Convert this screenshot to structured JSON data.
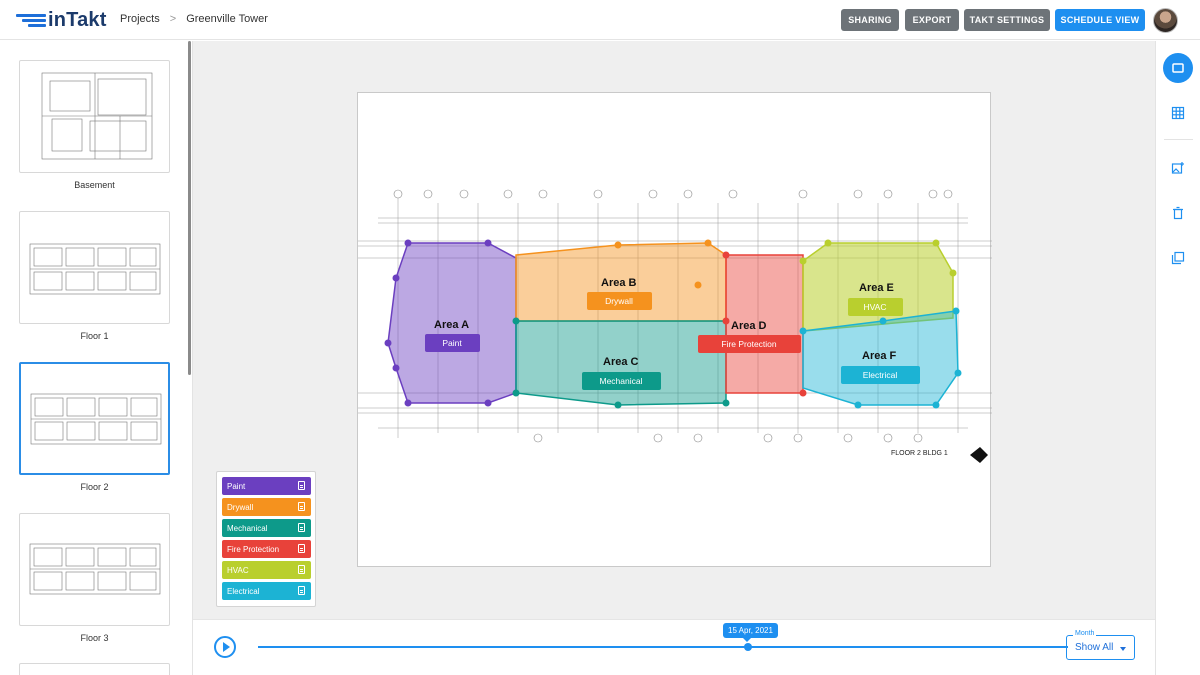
{
  "header": {
    "logo_text": "inTakt",
    "breadcrumb": {
      "root": "Projects",
      "separator": ">",
      "current": "Greenville Tower"
    },
    "buttons": {
      "sharing": "SHARING",
      "export": "EXPORT",
      "takt_settings": "TAKT SETTINGS",
      "schedule_view": "SCHEDULE VIEW"
    }
  },
  "sidebar": {
    "floors": [
      {
        "label": "Basement"
      },
      {
        "label": "Floor 1"
      },
      {
        "label": "Floor 2",
        "selected": true
      },
      {
        "label": "Floor 3"
      }
    ]
  },
  "plan": {
    "sheet_title": "FLOOR 2 BLDG 1",
    "areas": [
      {
        "name": "Area A",
        "trade": "Paint",
        "color": "#6b3fc0"
      },
      {
        "name": "Area B",
        "trade": "Drywall",
        "color": "#f5921e"
      },
      {
        "name": "Area C",
        "trade": "Mechanical",
        "color": "#0d9a8a"
      },
      {
        "name": "Area D",
        "trade": "Fire Protection",
        "color": "#e8423a"
      },
      {
        "name": "Area E",
        "trade": "HVAC",
        "color": "#b9cf2e"
      },
      {
        "name": "Area F",
        "trade": "Electrical",
        "color": "#1cb3d4"
      }
    ]
  },
  "legend": {
    "items": [
      {
        "label": "Paint",
        "color": "#6b3fc0",
        "icon": "document-icon"
      },
      {
        "label": "Drywall",
        "color": "#f5921e",
        "icon": "document-icon"
      },
      {
        "label": "Mechanical",
        "color": "#0d9a8a",
        "icon": "document-icon"
      },
      {
        "label": "Fire Protection",
        "color": "#e8423a",
        "icon": "document-icon"
      },
      {
        "label": "HVAC",
        "color": "#b9cf2e",
        "icon": "document-icon"
      },
      {
        "label": "Electrical",
        "color": "#1cb3d4",
        "icon": "document-icon"
      }
    ]
  },
  "timeline": {
    "date": "15 Apr, 2021",
    "position_fraction": 0.68,
    "month_label": "Month",
    "month_value": "Show All"
  },
  "rail": {
    "tools": [
      "single-view-icon",
      "grid-view-icon",
      "add-image-icon",
      "delete-icon",
      "copy-icon"
    ]
  },
  "colors": {
    "accent": "#1e8ff0",
    "header_button_grey": "#6d7378"
  }
}
